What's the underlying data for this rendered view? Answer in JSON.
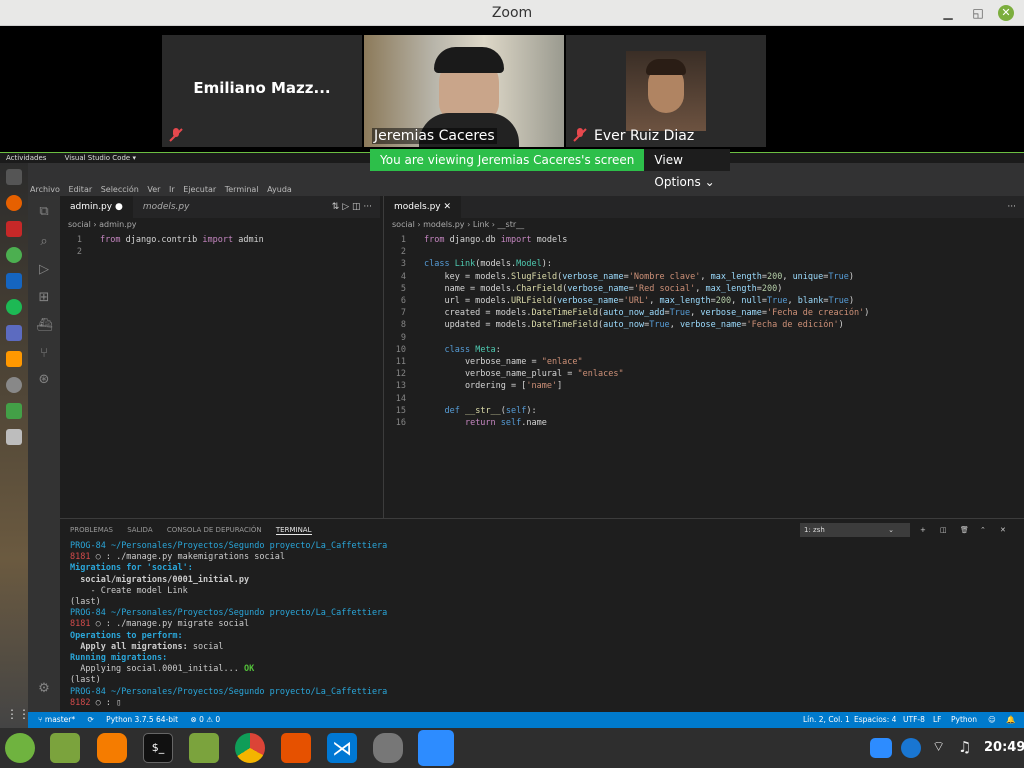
{
  "window": {
    "title": "Zoom"
  },
  "participants": [
    {
      "name": "Emiliano Mazz..."
    },
    {
      "name": "Jeremias Caceres"
    },
    {
      "name": "Ever Ruiz Diaz"
    }
  ],
  "banner": {
    "text": "You are viewing Jeremias Caceres's screen",
    "options": "View Options"
  },
  "gnome": {
    "activities": "Actividades",
    "app": "Visual Studio Code"
  },
  "vscode": {
    "menu": [
      "Archivo",
      "Editar",
      "Selección",
      "Ver",
      "Ir",
      "Ejecutar",
      "Terminal",
      "Ayuda"
    ],
    "left": {
      "tabs": [
        {
          "label": "admin.py"
        },
        {
          "label": "models.py"
        }
      ],
      "breadcrumb": [
        "social",
        "admin.py"
      ],
      "lines": [
        "from django.contrib import admin",
        ""
      ]
    },
    "right": {
      "tabs": [
        {
          "label": "models.py"
        }
      ],
      "breadcrumb": [
        "social",
        "models.py",
        "Link",
        "__str__"
      ]
    },
    "panel": {
      "tabs": [
        "PROBLEMAS",
        "SALIDA",
        "CONSOLA DE DEPURACIÓN",
        "TERMINAL"
      ],
      "shell": "1: zsh"
    },
    "status": {
      "branch": "master*",
      "python": "Python 3.7.5 64-bit",
      "problems": "⊗ 0 ⚠ 0",
      "position": "Lín. 2, Col. 1",
      "spaces": "Espacios: 4",
      "encoding": "UTF-8",
      "eol": "LF",
      "lang": "Python"
    }
  },
  "taskbar": {
    "clock": "20:49"
  },
  "colors": {
    "zoom_green": "#2dbf4a",
    "status_blue": "#007acc",
    "editor_bg": "#1e1e1e"
  }
}
